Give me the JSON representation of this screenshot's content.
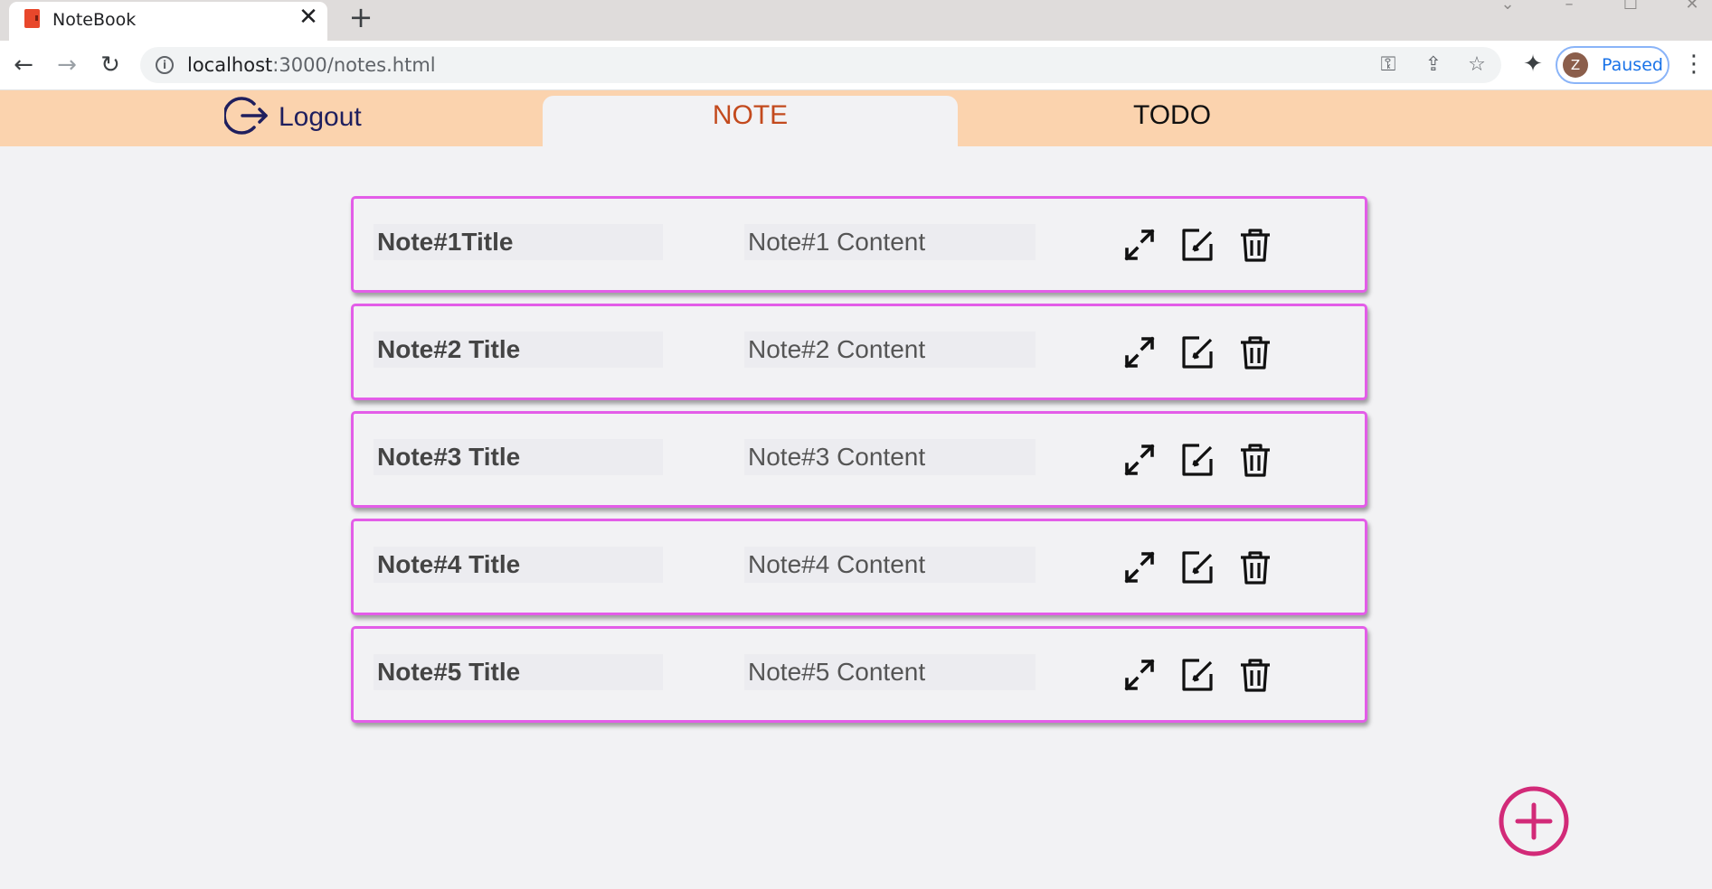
{
  "browser": {
    "tab_title": "NoteBook",
    "tab_close": "✕",
    "new_tab": "+",
    "url_host": "localhost",
    "url_path": ":3000/notes.html",
    "profile_initial": "Z",
    "profile_status": "Paused"
  },
  "header": {
    "logout_label": "Logout",
    "tabs": [
      {
        "label": "NOTE",
        "active": true
      },
      {
        "label": "TODO",
        "active": false
      }
    ]
  },
  "notes": [
    {
      "title": "Note#1Title",
      "content": "Note#1 Content"
    },
    {
      "title": "Note#2 Title",
      "content": "Note#2 Content"
    },
    {
      "title": "Note#3 Title",
      "content": "Note#3 Content"
    },
    {
      "title": "Note#4 Title",
      "content": "Note#4 Content"
    },
    {
      "title": "Note#5 Title",
      "content": "Note#5 Content"
    }
  ],
  "icons": {
    "note_actions": [
      "expand-icon",
      "edit-icon",
      "trash-icon"
    ],
    "fab": "add-circle-icon",
    "logout": "logout-icon"
  },
  "colors": {
    "header_bg": "#fbd3ae",
    "active_tab_text": "#c34a1d",
    "card_border": "#e35de8",
    "fab": "#d22a78",
    "logout": "#1f1f5e"
  }
}
